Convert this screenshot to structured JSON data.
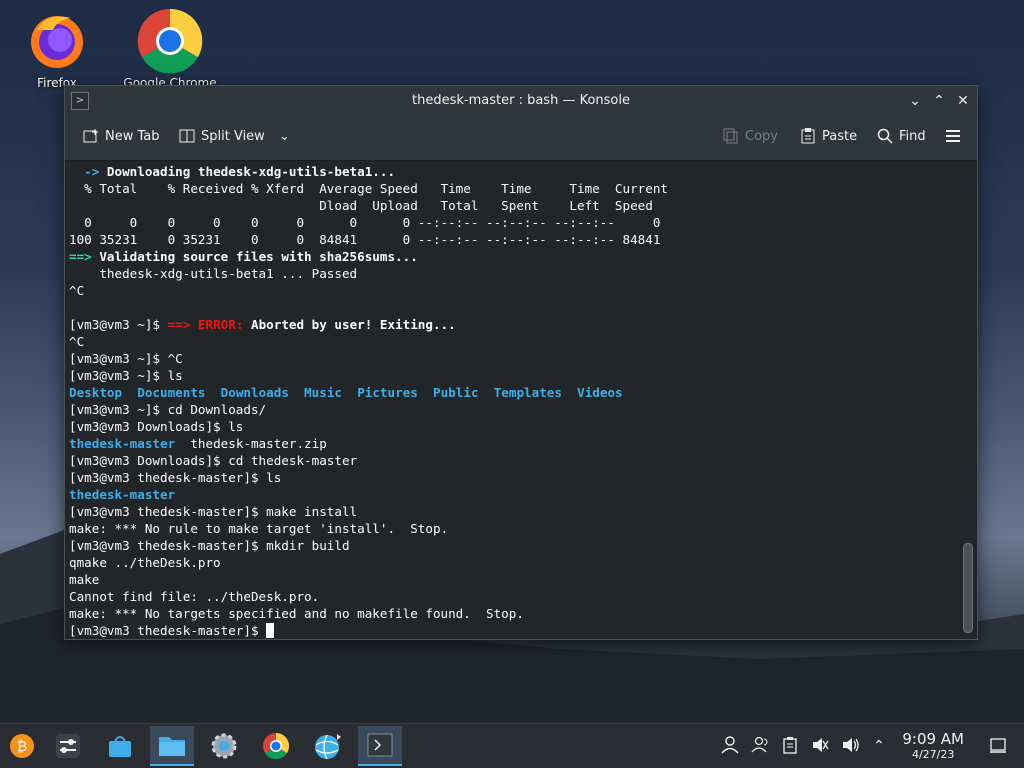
{
  "desktop": {
    "icons": [
      {
        "label": "Firefox"
      },
      {
        "label": "Google Chrome"
      }
    ]
  },
  "window": {
    "title": "thedesk-master : bash — Konsole",
    "toolbar": {
      "new_tab": "New Tab",
      "split_view": "Split View",
      "copy": "Copy",
      "paste": "Paste",
      "find": "Find"
    }
  },
  "terminal": {
    "lines": [
      [
        {
          "t": "  -> ",
          "c": "c-blue"
        },
        {
          "t": "Downloading thedesk-xdg-utils-beta1...",
          "c": "c-bold"
        }
      ],
      [
        {
          "t": "  % Total    % Received % Xferd  Average Speed   Time    Time     Time  Current"
        }
      ],
      [
        {
          "t": "                                 Dload  Upload   Total   Spent    Left  Speed"
        }
      ],
      [
        {
          "t": "  0     0    0     0    0     0      0      0 --:--:-- --:--:-- --:--:--     0"
        }
      ],
      [
        {
          "t": "100 35231    0 35231    0     0  84841      0 --:--:-- --:--:-- --:--:-- 84841"
        }
      ],
      [
        {
          "t": "==> ",
          "c": "c-green"
        },
        {
          "t": "Validating source files with sha256sums...",
          "c": "c-bold"
        }
      ],
      [
        {
          "t": "    thedesk-xdg-utils-beta1 ... Passed"
        }
      ],
      [
        {
          "t": "^C"
        }
      ],
      [
        {
          "t": ""
        }
      ],
      [
        {
          "t": "[vm3@vm3 ~]$ "
        },
        {
          "t": "==> ",
          "c": "c-red"
        },
        {
          "t": "ERROR: ",
          "c": "c-red"
        },
        {
          "t": "Aborted by user! Exiting...",
          "c": "c-bold"
        }
      ],
      [
        {
          "t": "^C"
        }
      ],
      [
        {
          "t": "[vm3@vm3 ~]$ ^C"
        }
      ],
      [
        {
          "t": "[vm3@vm3 ~]$ ls"
        }
      ],
      [
        {
          "t": "Desktop",
          "c": "c-blue"
        },
        {
          "t": "  "
        },
        {
          "t": "Documents",
          "c": "c-blue"
        },
        {
          "t": "  "
        },
        {
          "t": "Downloads",
          "c": "c-blue"
        },
        {
          "t": "  "
        },
        {
          "t": "Music",
          "c": "c-blue"
        },
        {
          "t": "  "
        },
        {
          "t": "Pictures",
          "c": "c-blue"
        },
        {
          "t": "  "
        },
        {
          "t": "Public",
          "c": "c-blue"
        },
        {
          "t": "  "
        },
        {
          "t": "Templates",
          "c": "c-blue"
        },
        {
          "t": "  "
        },
        {
          "t": "Videos",
          "c": "c-blue"
        }
      ],
      [
        {
          "t": "[vm3@vm3 ~]$ cd Downloads/"
        }
      ],
      [
        {
          "t": "[vm3@vm3 Downloads]$ ls"
        }
      ],
      [
        {
          "t": "thedesk-master",
          "c": "c-blue"
        },
        {
          "t": "  thedesk-master.zip"
        }
      ],
      [
        {
          "t": "[vm3@vm3 Downloads]$ cd thedesk-master"
        }
      ],
      [
        {
          "t": "[vm3@vm3 thedesk-master]$ ls"
        }
      ],
      [
        {
          "t": "thedesk-master",
          "c": "c-blue"
        }
      ],
      [
        {
          "t": "[vm3@vm3 thedesk-master]$ make install"
        }
      ],
      [
        {
          "t": "make: *** No rule to make target 'install'.  Stop."
        }
      ],
      [
        {
          "t": "[vm3@vm3 thedesk-master]$ mkdir build"
        }
      ],
      [
        {
          "t": "qmake ../theDesk.pro"
        }
      ],
      [
        {
          "t": "make"
        }
      ],
      [
        {
          "t": "Cannot find file: ../theDesk.pro."
        }
      ],
      [
        {
          "t": "make: *** No targets specified and no makefile found.  Stop."
        }
      ],
      [
        {
          "t": "[vm3@vm3 thedesk-master]$ "
        }
      ]
    ],
    "scroll_position": 1.0
  },
  "taskbar": {
    "time": "9:09 AM",
    "date": "4/27/23",
    "tasks": [
      {
        "name": "bitcoin-icon"
      },
      {
        "name": "settings-sliders-icon"
      },
      {
        "name": "store-icon"
      },
      {
        "name": "file-manager-icon"
      },
      {
        "name": "system-settings-icon"
      },
      {
        "name": "chrome-icon"
      },
      {
        "name": "network-globe-icon"
      },
      {
        "name": "konsole-icon"
      }
    ]
  },
  "colors": {
    "accent": "#3daee9",
    "terminal_bg": "#232629",
    "error_red": "#ed1515",
    "arrow_green": "#1cdc9a"
  }
}
